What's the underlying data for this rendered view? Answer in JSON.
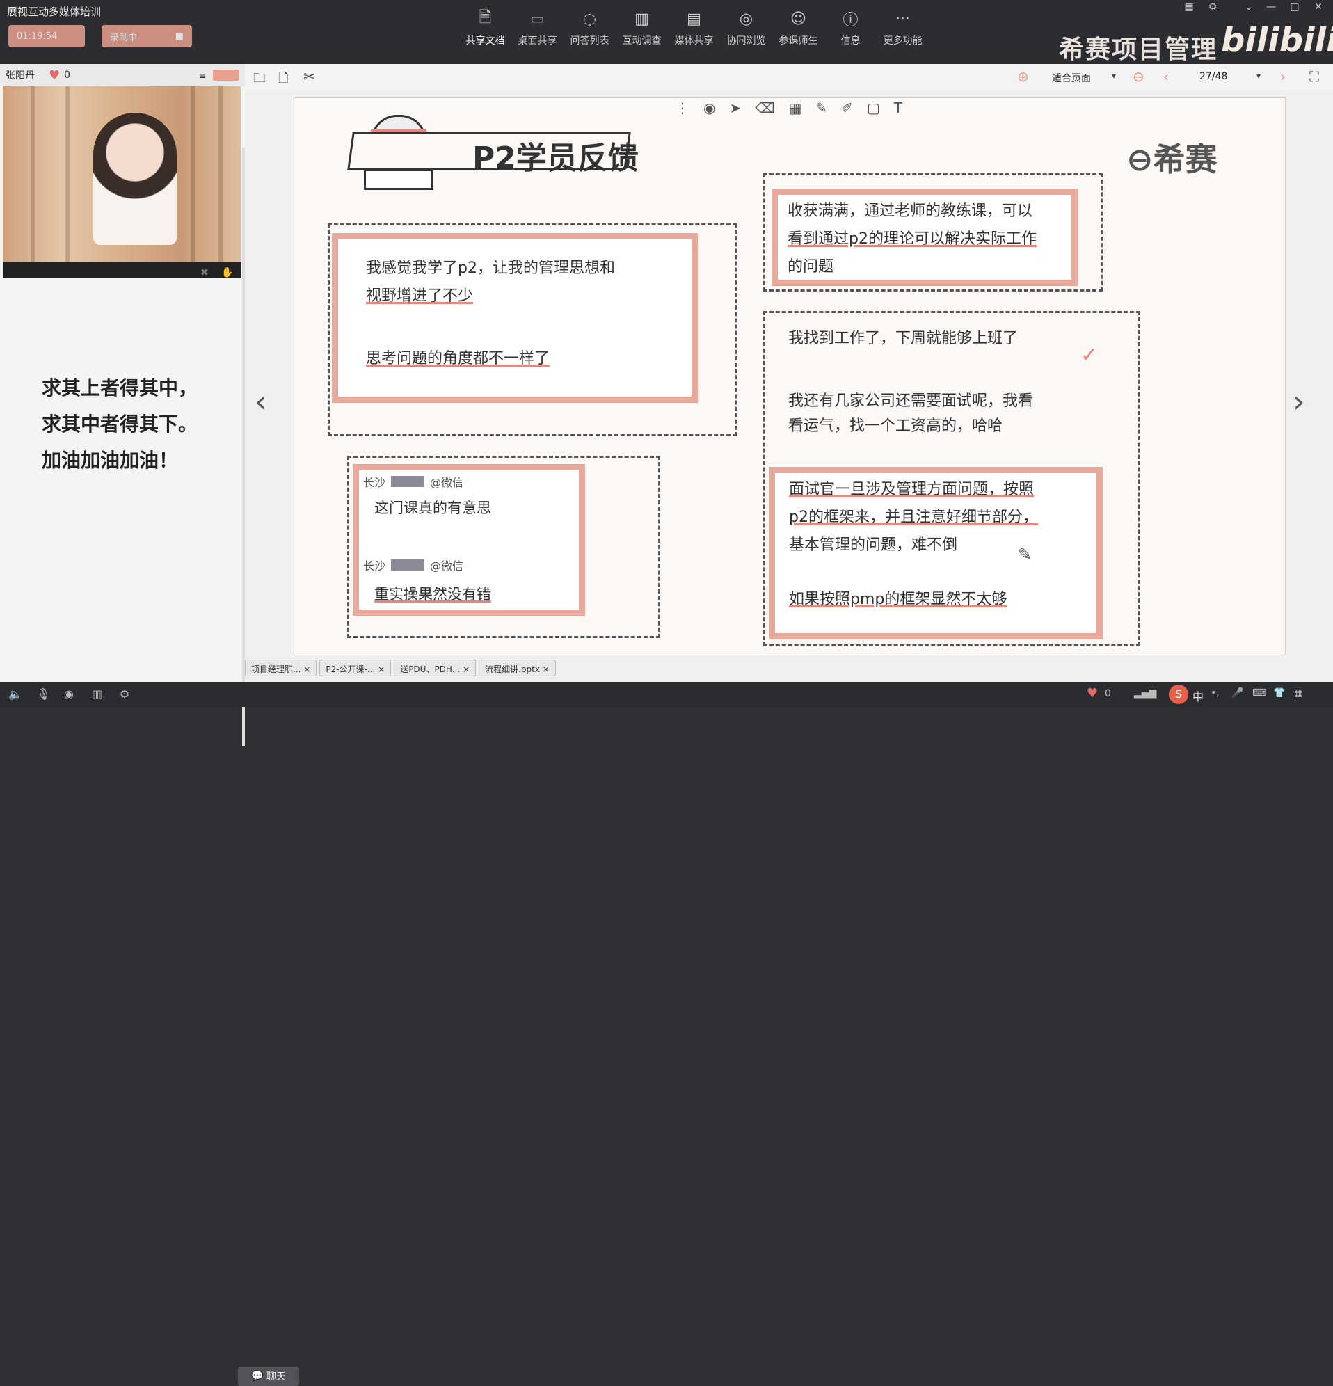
{
  "app": {
    "title": "展视互动多媒体培训",
    "timer_label": "01:19:54",
    "record_label": "录制中"
  },
  "toolbar": {
    "items": [
      {
        "label": "共享文档",
        "icon": "doc-share-icon"
      },
      {
        "label": "桌面共享",
        "icon": "desktop-share-icon"
      },
      {
        "label": "问答列表",
        "icon": "qa-icon"
      },
      {
        "label": "互动调查",
        "icon": "survey-icon"
      },
      {
        "label": "媒体共享",
        "icon": "media-icon"
      },
      {
        "label": "协同浏览",
        "icon": "browse-icon"
      },
      {
        "label": "参课师生",
        "icon": "people-icon"
      },
      {
        "label": "信息",
        "icon": "info-icon"
      },
      {
        "label": "更多功能",
        "icon": "more-icon"
      }
    ]
  },
  "brand": {
    "text": "希赛项目管理",
    "bili": "bilibili"
  },
  "left": {
    "user_name": "张阳丹",
    "likes": "0",
    "motto": [
      "求其上者得其中，",
      "求其中者得其下。",
      "加油加油加油！"
    ]
  },
  "viewbar": {
    "fit_label": "适合页面",
    "page": "27/48"
  },
  "slide": {
    "title": "P2学员反馈",
    "logo": "希赛",
    "box1": [
      "我感觉我学了p2，让我的管理思想和",
      "视野增进了不少"
    ],
    "box1_tail": "思考问题的角度都不一样了",
    "wechat_city1": "长沙",
    "wechat_tag1": "@微信",
    "wechat_msg1": "这门课真的有意思",
    "wechat_city2": "长沙",
    "wechat_tag2": "@微信",
    "wechat_msg2": "重实操果然没有错",
    "right1": [
      "收获满满，通过老师的教练课，可以",
      "看到通过p2的理论可以解决实际工作",
      "的问题"
    ],
    "right2a": "我找到工作了，下周就能够上班了",
    "right2b": [
      "我还有几家公司还需要面试呢，我看",
      "看运气，找一个工资高的，哈哈"
    ],
    "right3": [
      "面试官一旦涉及管理方面问题，按照",
      "p2的框架来，并且注意好细节部分，",
      "基本管理的问题，难不倒"
    ],
    "right3_tail": "如果按照pmp的框架显然不太够"
  },
  "filetabs": [
    "项目经理职...",
    "P2-公开课-...",
    "送PDU、PDH...",
    "流程细讲.pptx"
  ],
  "bottom": {
    "chat_label": "聊天",
    "likes": "0",
    "ime": "中"
  }
}
